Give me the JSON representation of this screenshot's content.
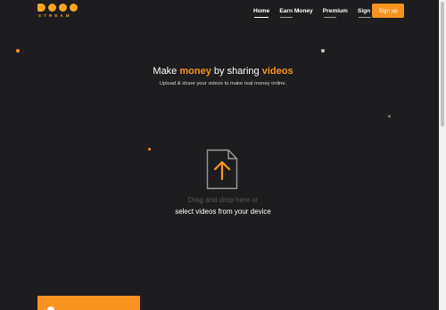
{
  "brand": {
    "logo_text": "STREAM",
    "accent": "#f7931e"
  },
  "nav": {
    "links": [
      {
        "label": "Home",
        "active": true
      },
      {
        "label": "Earn Money",
        "active": false
      },
      {
        "label": "Premium",
        "active": false
      },
      {
        "label": "Sign in",
        "active": false
      }
    ],
    "signup_label": "Sign up"
  },
  "hero": {
    "title_prefix": "Make ",
    "title_money": "money",
    "title_mid": " by sharing ",
    "title_videos": "videos",
    "subtitle": "Upload & share your videos to make real money online."
  },
  "upload": {
    "icon": "file-upload-icon",
    "drop_hint": "Drag and drop here or",
    "select_label": "select videos from your device"
  },
  "colors": {
    "background": "#1d1d1f",
    "accent": "#f7931e",
    "muted_text": "#555555"
  }
}
